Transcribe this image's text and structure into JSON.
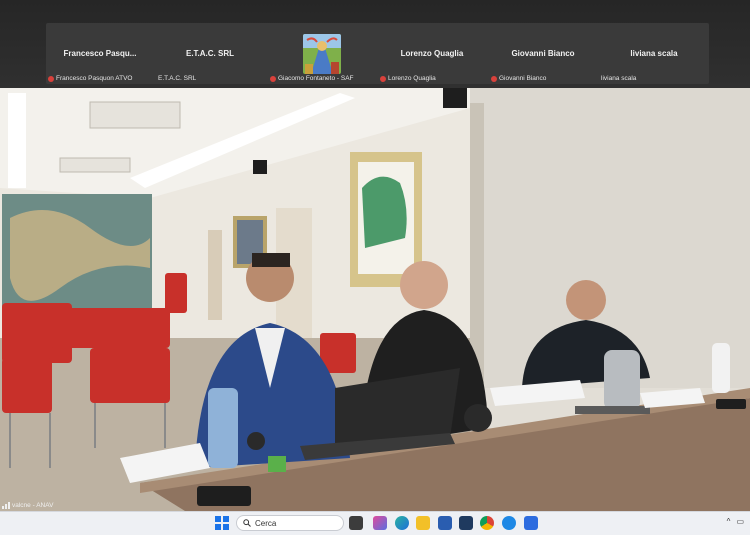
{
  "participants": [
    {
      "name": "Francesco  Pasqu...",
      "caption": "Francesco Pasquon ATVO",
      "muted": true
    },
    {
      "name": "E.T.A.C. SRL",
      "caption": "E.T.A.C. SRL",
      "muted": false
    },
    {
      "name": "",
      "caption": "Giacomo Fontaneto - SAF",
      "muted": true,
      "has_avatar_image": true
    },
    {
      "name": "Lorenzo Quaglia",
      "caption": "Lorenzo Quaglia",
      "muted": true
    },
    {
      "name": "Giovanni Bianco",
      "caption": "Giovanni Bianco",
      "muted": true
    },
    {
      "name": "liviana scala",
      "caption": "liviana scala",
      "muted": false
    }
  ],
  "main_video": {
    "label": "valcne - ANAV"
  },
  "taskbar": {
    "search_placeholder": "Cerca",
    "tray_chevron": "^",
    "tray_network": "▭"
  },
  "colors": {
    "muted_indicator": "#d9413b",
    "strip_background": "#3a3a3a"
  }
}
